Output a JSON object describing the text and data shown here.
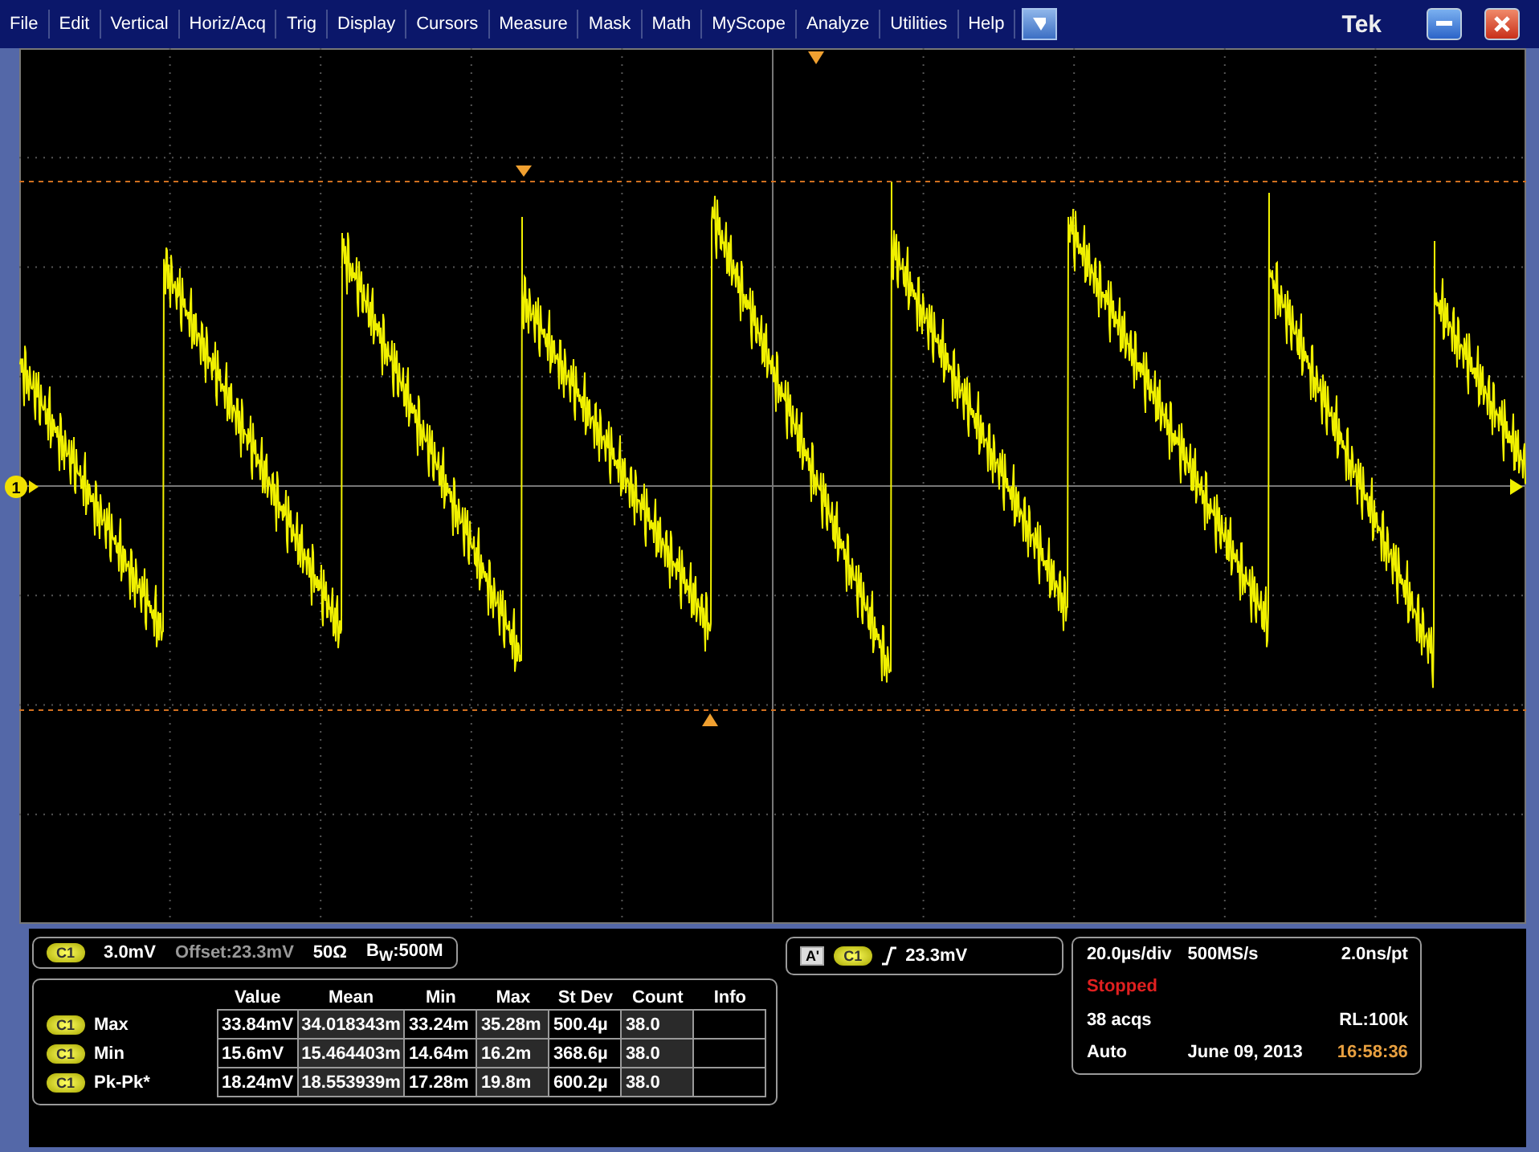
{
  "menu": [
    "File",
    "Edit",
    "Vertical",
    "Horiz/Acq",
    "Trig",
    "Display",
    "Cursors",
    "Measure",
    "Mask",
    "Math",
    "MyScope",
    "Analyze",
    "Utilities",
    "Help"
  ],
  "brand": "Tek",
  "channel_marker": "1",
  "channel_info": {
    "badge": "C1",
    "scale": "3.0mV",
    "offset": "Offset:23.3mV",
    "impedance": "50Ω",
    "bandwidth": "B$_{W}$:500M"
  },
  "measurements": {
    "columns": [
      "Value",
      "Mean",
      "Min",
      "Max",
      "St Dev",
      "Count",
      "Info"
    ],
    "rows": [
      {
        "badge": "C1",
        "name": "Max",
        "cells": [
          "33.84mV",
          "34.018343m",
          "33.24m",
          "35.28m",
          "500.4µ",
          "38.0",
          ""
        ]
      },
      {
        "badge": "C1",
        "name": "Min",
        "cells": [
          "15.6mV",
          "15.464403m",
          "14.64m",
          "16.2m",
          "368.6µ",
          "38.0",
          ""
        ]
      },
      {
        "badge": "C1",
        "name": "Pk-Pk*",
        "cells": [
          "18.24mV",
          "18.553939m",
          "17.28m",
          "19.8m",
          "600.2µ",
          "38.0",
          ""
        ]
      }
    ]
  },
  "trigger": {
    "mode": "A'",
    "badge": "C1",
    "level": "23.3mV"
  },
  "timebase": {
    "scale": "20.0µs/div",
    "rate": "500MS/s",
    "resolution": "2.0ns/pt",
    "status": "Stopped",
    "acquisitions": "38 acqs",
    "record_length": "RL:100k",
    "trigger_mode": "Auto",
    "date": "June 09, 2013",
    "time": "16:58:36"
  }
}
